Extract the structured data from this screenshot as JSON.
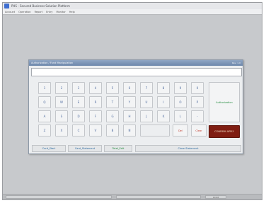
{
  "window": {
    "title": "PHS - Secured Business Solution Platform",
    "menu": [
      "Account",
      "Operation",
      "Report",
      "Entry",
      "Monitor",
      "Help"
    ]
  },
  "status": {
    "cells": [
      "",
      "",
      "10:48"
    ]
  },
  "dialog": {
    "title": "Authorization / Fund Manipulation",
    "title_right": "Rev. 1.0",
    "input_value": "",
    "keys": {
      "row1": [
        "1",
        "2",
        "3",
        "4",
        "5",
        "6",
        "7",
        "8",
        "9",
        "0"
      ],
      "row2": [
        "Q",
        "W",
        "E",
        "R",
        "T",
        "Y",
        "U",
        "I",
        "O",
        "P"
      ],
      "row3": [
        "A",
        "S",
        "D",
        "F",
        "G",
        "H",
        "J",
        "K",
        "L",
        "-"
      ],
      "row4": [
        "Z",
        "X",
        "C",
        "V",
        "B",
        "N"
      ]
    },
    "delete_label": "Del",
    "clear_label": "Clear",
    "enter_label": "Authorization",
    "apply_label": "CONFIRM APPLY",
    "bottom_buttons": [
      "Card_Start",
      "Card_Statement",
      "Total_Edit",
      "Close Statement"
    ]
  },
  "colors": {
    "workspace": "#c7c9cc",
    "title_bar": "#6d87ab",
    "key_text": "#4d6a9e",
    "action_text": "#c0392b",
    "apply_bg": "#7f1d12",
    "enter_text": "#1f8a3b"
  }
}
